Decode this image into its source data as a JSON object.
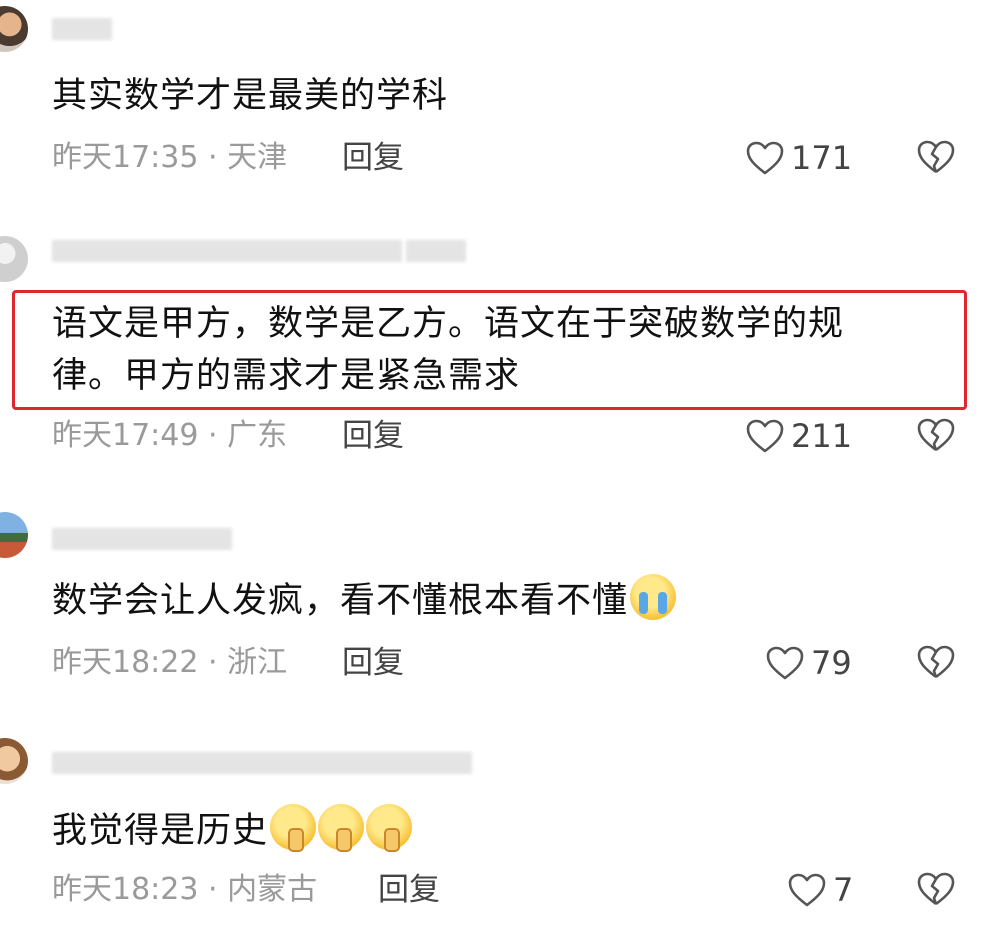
{
  "comments": [
    {
      "text": "其实数学才是最美的学科",
      "meta": "昨天17:35 · 天津",
      "reply": "回复",
      "likes": "171"
    },
    {
      "text_line1": "语文是甲方，数学是乙方。语文在于突破数学的规",
      "text_line2": "律。甲方的需求才是紧急需求",
      "meta": "昨天17:49 · 广东",
      "reply": "回复",
      "likes": "211"
    },
    {
      "text": "数学会让人发疯，看不懂根本看不懂",
      "emoji": "loudly-crying-face",
      "meta": "昨天18:22 · 浙江",
      "reply": "回复",
      "likes": "79"
    },
    {
      "text": "我觉得是历史",
      "emoji": "shushing-face",
      "emoji_count": 3,
      "meta": "昨天18:23 · 内蒙古",
      "reply": "回复",
      "likes": "7"
    }
  ],
  "colors": {
    "highlight_border": "#e0262f",
    "meta_text": "#9a9a9a"
  }
}
